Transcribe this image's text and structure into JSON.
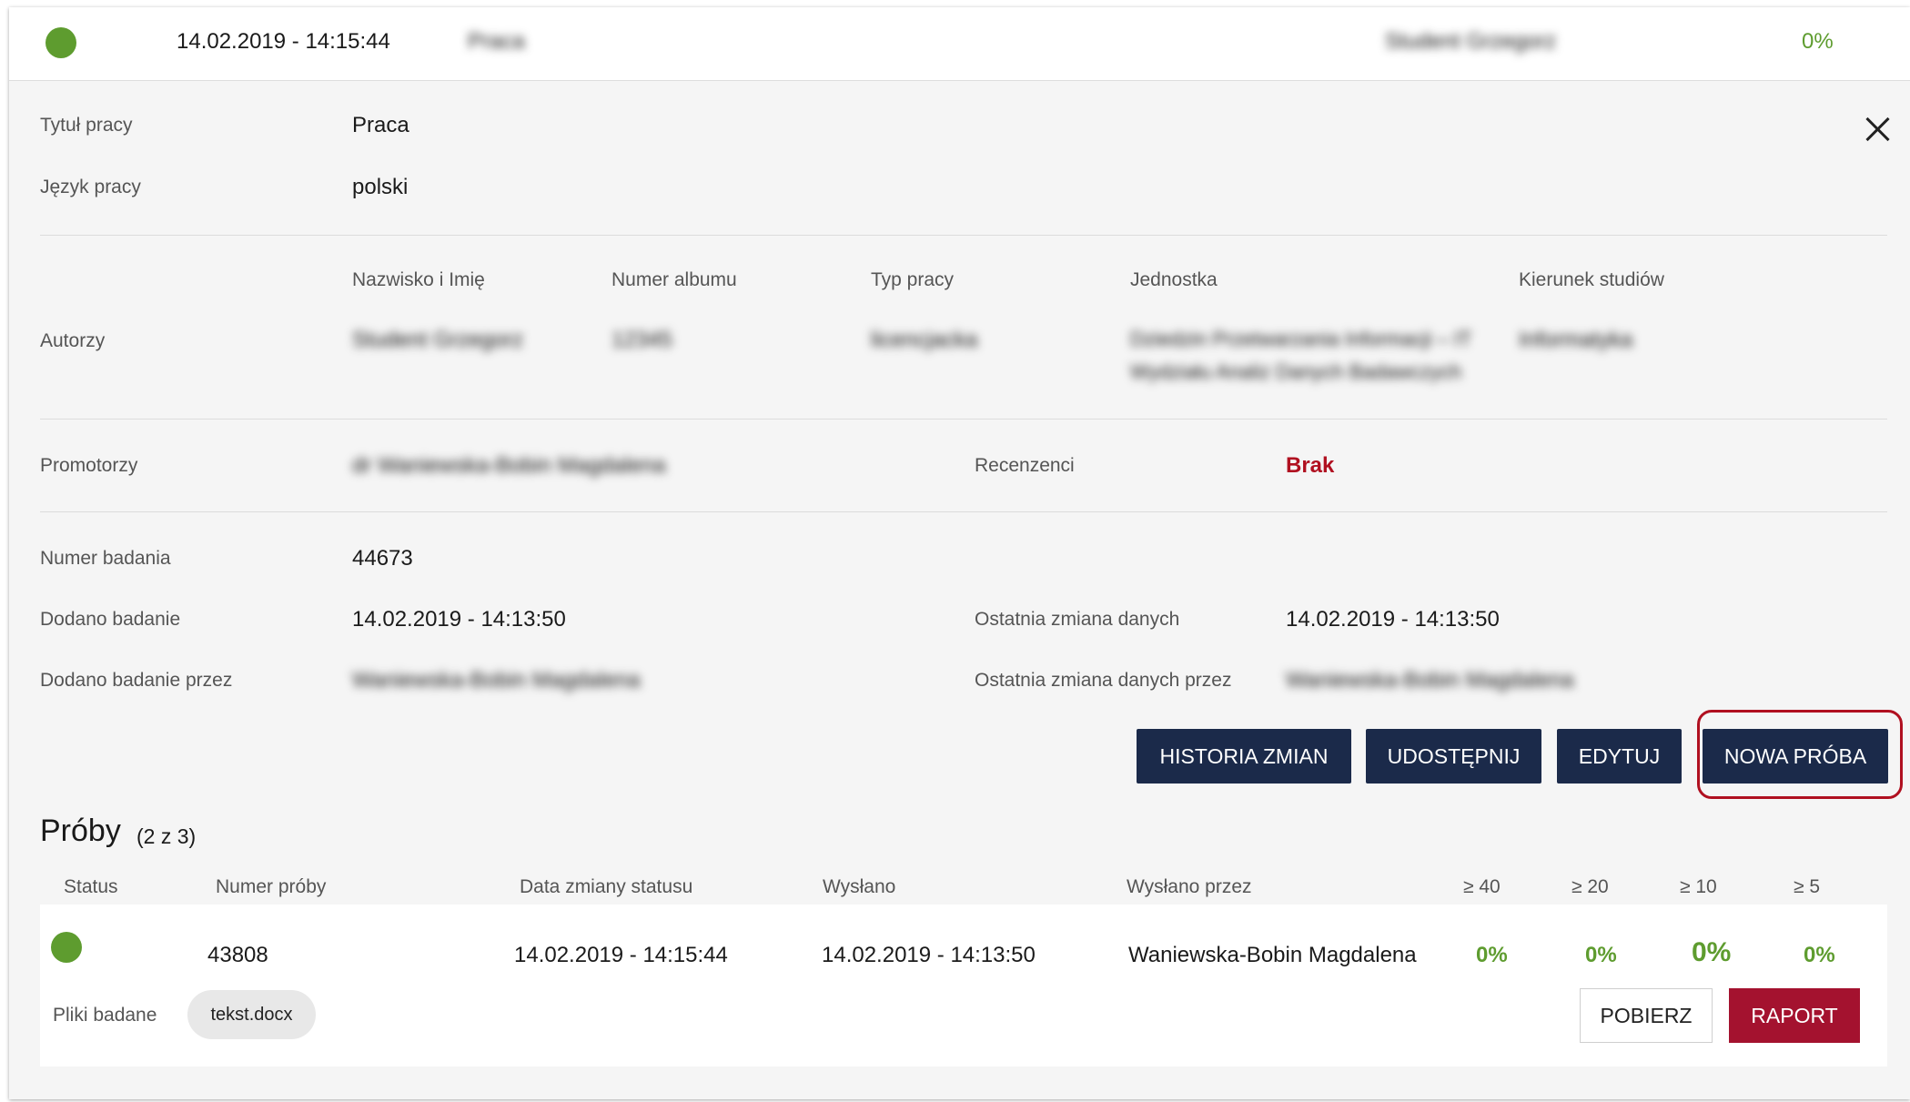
{
  "colors": {
    "status_green": "#5e9c2f",
    "accent_navy": "#1b2a4a",
    "danger_red": "#a4122f",
    "brak_red": "#b01020"
  },
  "topbar": {
    "status": "green",
    "date": "14.02.2019 - 14:15:44",
    "title_blurred": "Praca",
    "author_blurred": "Student Grzegorz",
    "percent": "0%"
  },
  "details": {
    "title_label": "Tytuł pracy",
    "title_value": "Praca",
    "lang_label": "Język pracy",
    "lang_value": "polski",
    "authors_label": "Autorzy",
    "authors_headers": [
      "Nazwisko i Imię",
      "Numer albumu",
      "Typ pracy",
      "Jednostka",
      "Kierunek studiów"
    ],
    "authors_row_blurred": [
      "Student Grzegorz",
      "12345",
      "licencjacka",
      "Dziedzin Przetwarzania Informacji – IT",
      "Informatyka"
    ],
    "authors_unit_line2_blurred": "Wydziału Analiz Danych Badawczych",
    "promoters_label": "Promotorzy",
    "promoters_value_blurred": "dr Waniewska-Bobin Magdalena",
    "reviewers_label": "Recenzenci",
    "reviewers_value": "Brak",
    "number_label": "Numer badania",
    "number_value": "44673",
    "added_label": "Dodano badanie",
    "added_value": "14.02.2019 - 14:13:50",
    "last_change_label": "Ostatnia zmiana danych",
    "last_change_value": "14.02.2019 - 14:13:50",
    "added_by_label": "Dodano badanie przez",
    "added_by_value_blurred": "Waniewska-Bobin Magdalena",
    "last_change_by_label": "Ostatnia zmiana danych przez",
    "last_change_by_value_blurred": "Waniewska-Bobin Magdalena"
  },
  "actions": {
    "history": "HISTORIA ZMIAN",
    "share": "UDOSTĘPNIJ",
    "edit": "EDYTUJ",
    "new_attempt": "NOWA PRÓBA"
  },
  "attempts": {
    "title": "Próby",
    "count": "(2 z 3)",
    "headers": [
      "Status",
      "Numer próby",
      "Data zmiany statusu",
      "Wysłano",
      "Wysłano przez",
      "≥ 40",
      "≥ 20",
      "≥ 10",
      "≥ 5"
    ],
    "row": {
      "status": "green",
      "number": "43808",
      "status_date": "14.02.2019 - 14:15:44",
      "sent": "14.02.2019 - 14:13:50",
      "sent_by": "Waniewska-Bobin Magdalena",
      "p40": "0%",
      "p20": "0%",
      "p10": "0%",
      "p5": "0%",
      "files_label": "Pliki badane",
      "file": "tekst.docx",
      "download": "POBIERZ",
      "report": "RAPORT"
    }
  }
}
